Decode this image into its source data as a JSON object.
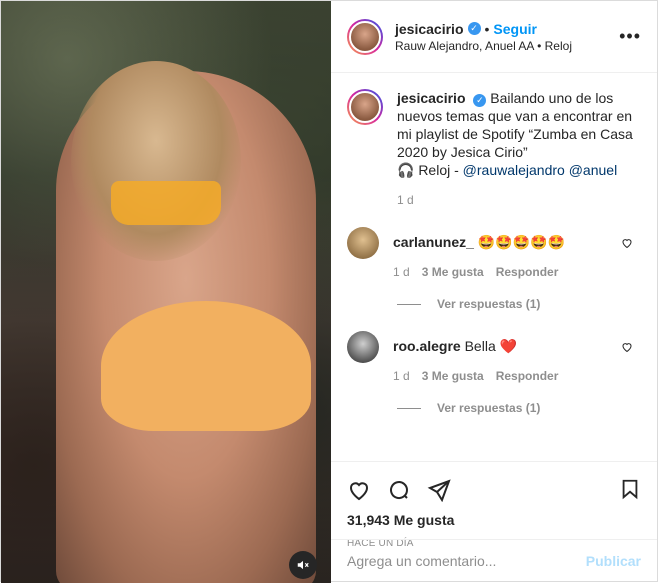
{
  "header": {
    "username": "jesicacirio",
    "verified_icon": "verified-badge-icon",
    "separator": "•",
    "follow_label": "Seguir",
    "subtitle": "Rauw Alejandro, Anuel AA • Reloj",
    "more_icon": "more-options-icon"
  },
  "caption": {
    "username": "jesicacirio",
    "text": "Bailando uno de los nuevos temas que van a encontrar en mi playlist de Spotify “Zumba en Casa 2020 by Jesica Cirio”",
    "song_prefix": "🎧 Reloj - ",
    "mention1": "@rauwalejandro",
    "mention2": "@anuel",
    "time": "1 d"
  },
  "comments": [
    {
      "username": "carlanunez_",
      "text": "🤩🤩🤩🤩🤩",
      "time": "1 d",
      "likes": "3 Me gusta",
      "reply": "Responder",
      "view_replies": "Ver respuestas (1)",
      "avatar_color": "#b89a6a"
    },
    {
      "username": "roo.alegre",
      "text": "Bella ❤️",
      "time": "1 d",
      "likes": "3 Me gusta",
      "reply": "Responder",
      "view_replies": "Ver respuestas (1)",
      "avatar_color": "#6a6a6a"
    }
  ],
  "actions": {
    "likes": "31,943 Me gusta",
    "ago": "HACE UN DÍA"
  },
  "composer": {
    "placeholder": "Agrega un comentario...",
    "publish_label": "Publicar"
  },
  "colors": {
    "accent": "#0095f6",
    "publish_disabled": "#b2dffc",
    "mention": "#00376b",
    "muted": "#8e8e8e"
  }
}
